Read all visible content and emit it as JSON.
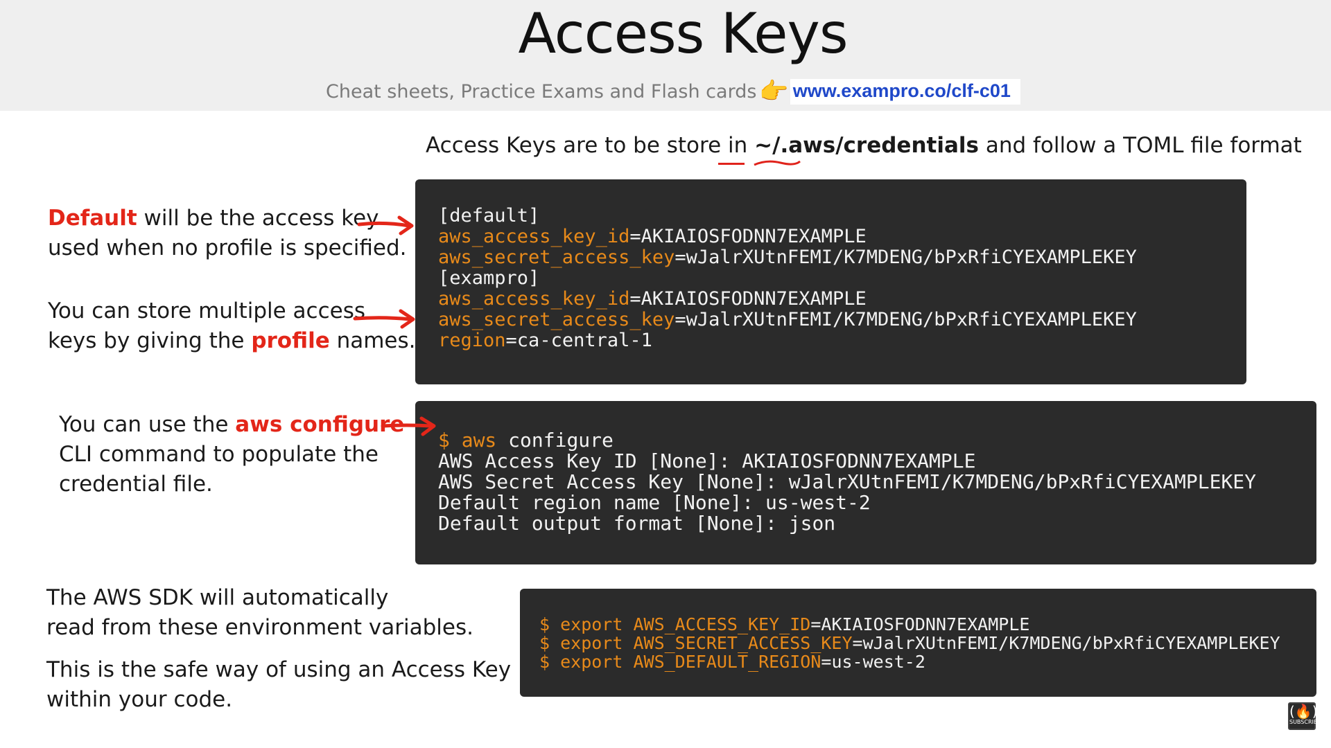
{
  "header": {
    "title": "Access Keys",
    "subtitle": "Cheat sheets, Practice Exams and Flash cards",
    "pointing_icon": "👉",
    "url": "www.exampro.co/clf-c01"
  },
  "intro": {
    "prefix": "Access Keys are to be store in ",
    "path": "~/.aws/credentials",
    "suffix": " and follow a TOML file format"
  },
  "annotations": {
    "default": {
      "highlight": "Default",
      "line1_rest": " will be the access key",
      "line2": "used when no profile is specified."
    },
    "profiles": {
      "line1": "You can store multiple access",
      "line2_prefix": "keys by giving the ",
      "highlight": "profile",
      "line2_suffix": " names."
    },
    "configure": {
      "line1_prefix": "You can use the ",
      "highlight": "aws configure",
      "line2": "CLI command to populate the",
      "line3": "credential file."
    },
    "sdk": {
      "line1": "The AWS SDK will automatically",
      "line2": "read from these environment variables.",
      "line3": "This is the safe way of using an Access Key",
      "line4": "within your code."
    }
  },
  "credentials_file": {
    "lines": [
      {
        "key": "",
        "value": "[default]"
      },
      {
        "key": "aws_access_key_id",
        "value": "=AKIAIOSFODNN7EXAMPLE"
      },
      {
        "key": "aws_secret_access_key",
        "value": "=wJalrXUtnFEMI/K7MDENG/bPxRfiCYEXAMPLEKEY"
      },
      {
        "key": "",
        "value": "[exampro]"
      },
      {
        "key": "aws_access_key_id",
        "value": "=AKIAIOSFODNN7EXAMPLE"
      },
      {
        "key": "aws_secret_access_key",
        "value": "=wJalrXUtnFEMI/K7MDENG/bPxRfiCYEXAMPLEKEY"
      },
      {
        "key": "region",
        "value": "=ca-central-1"
      }
    ]
  },
  "configure_terminal": {
    "prompt": "$ aws",
    "command": " configure",
    "lines": [
      "AWS Access Key ID [None]: AKIAIOSFODNN7EXAMPLE",
      "AWS Secret Access Key [None]: wJalrXUtnFEMI/K7MDENG/bPxRfiCYEXAMPLEKEY",
      "Default region name [None]: us-west-2",
      "Default output format [None]: json"
    ]
  },
  "env_terminal": {
    "lines": [
      {
        "prefix": "$ export AWS_ACCESS_KEY_ID",
        "value": "=AKIAIOSFODNN7EXAMPLE"
      },
      {
        "prefix": "$ export AWS_SECRET_ACCESS_KEY",
        "value": "=wJalrXUtnFEMI/K7MDENG/bPxRfiCYEXAMPLEKEY"
      },
      {
        "prefix": "$ export AWS_DEFAULT_REGION",
        "value": "=us-west-2"
      }
    ]
  },
  "badge": {
    "label": "SUBSCRIBE"
  },
  "colors": {
    "accent_red": "#e32619",
    "code_orange": "#e88a1a",
    "code_bg": "#2b2b2b",
    "link_blue": "#1f48c9"
  }
}
